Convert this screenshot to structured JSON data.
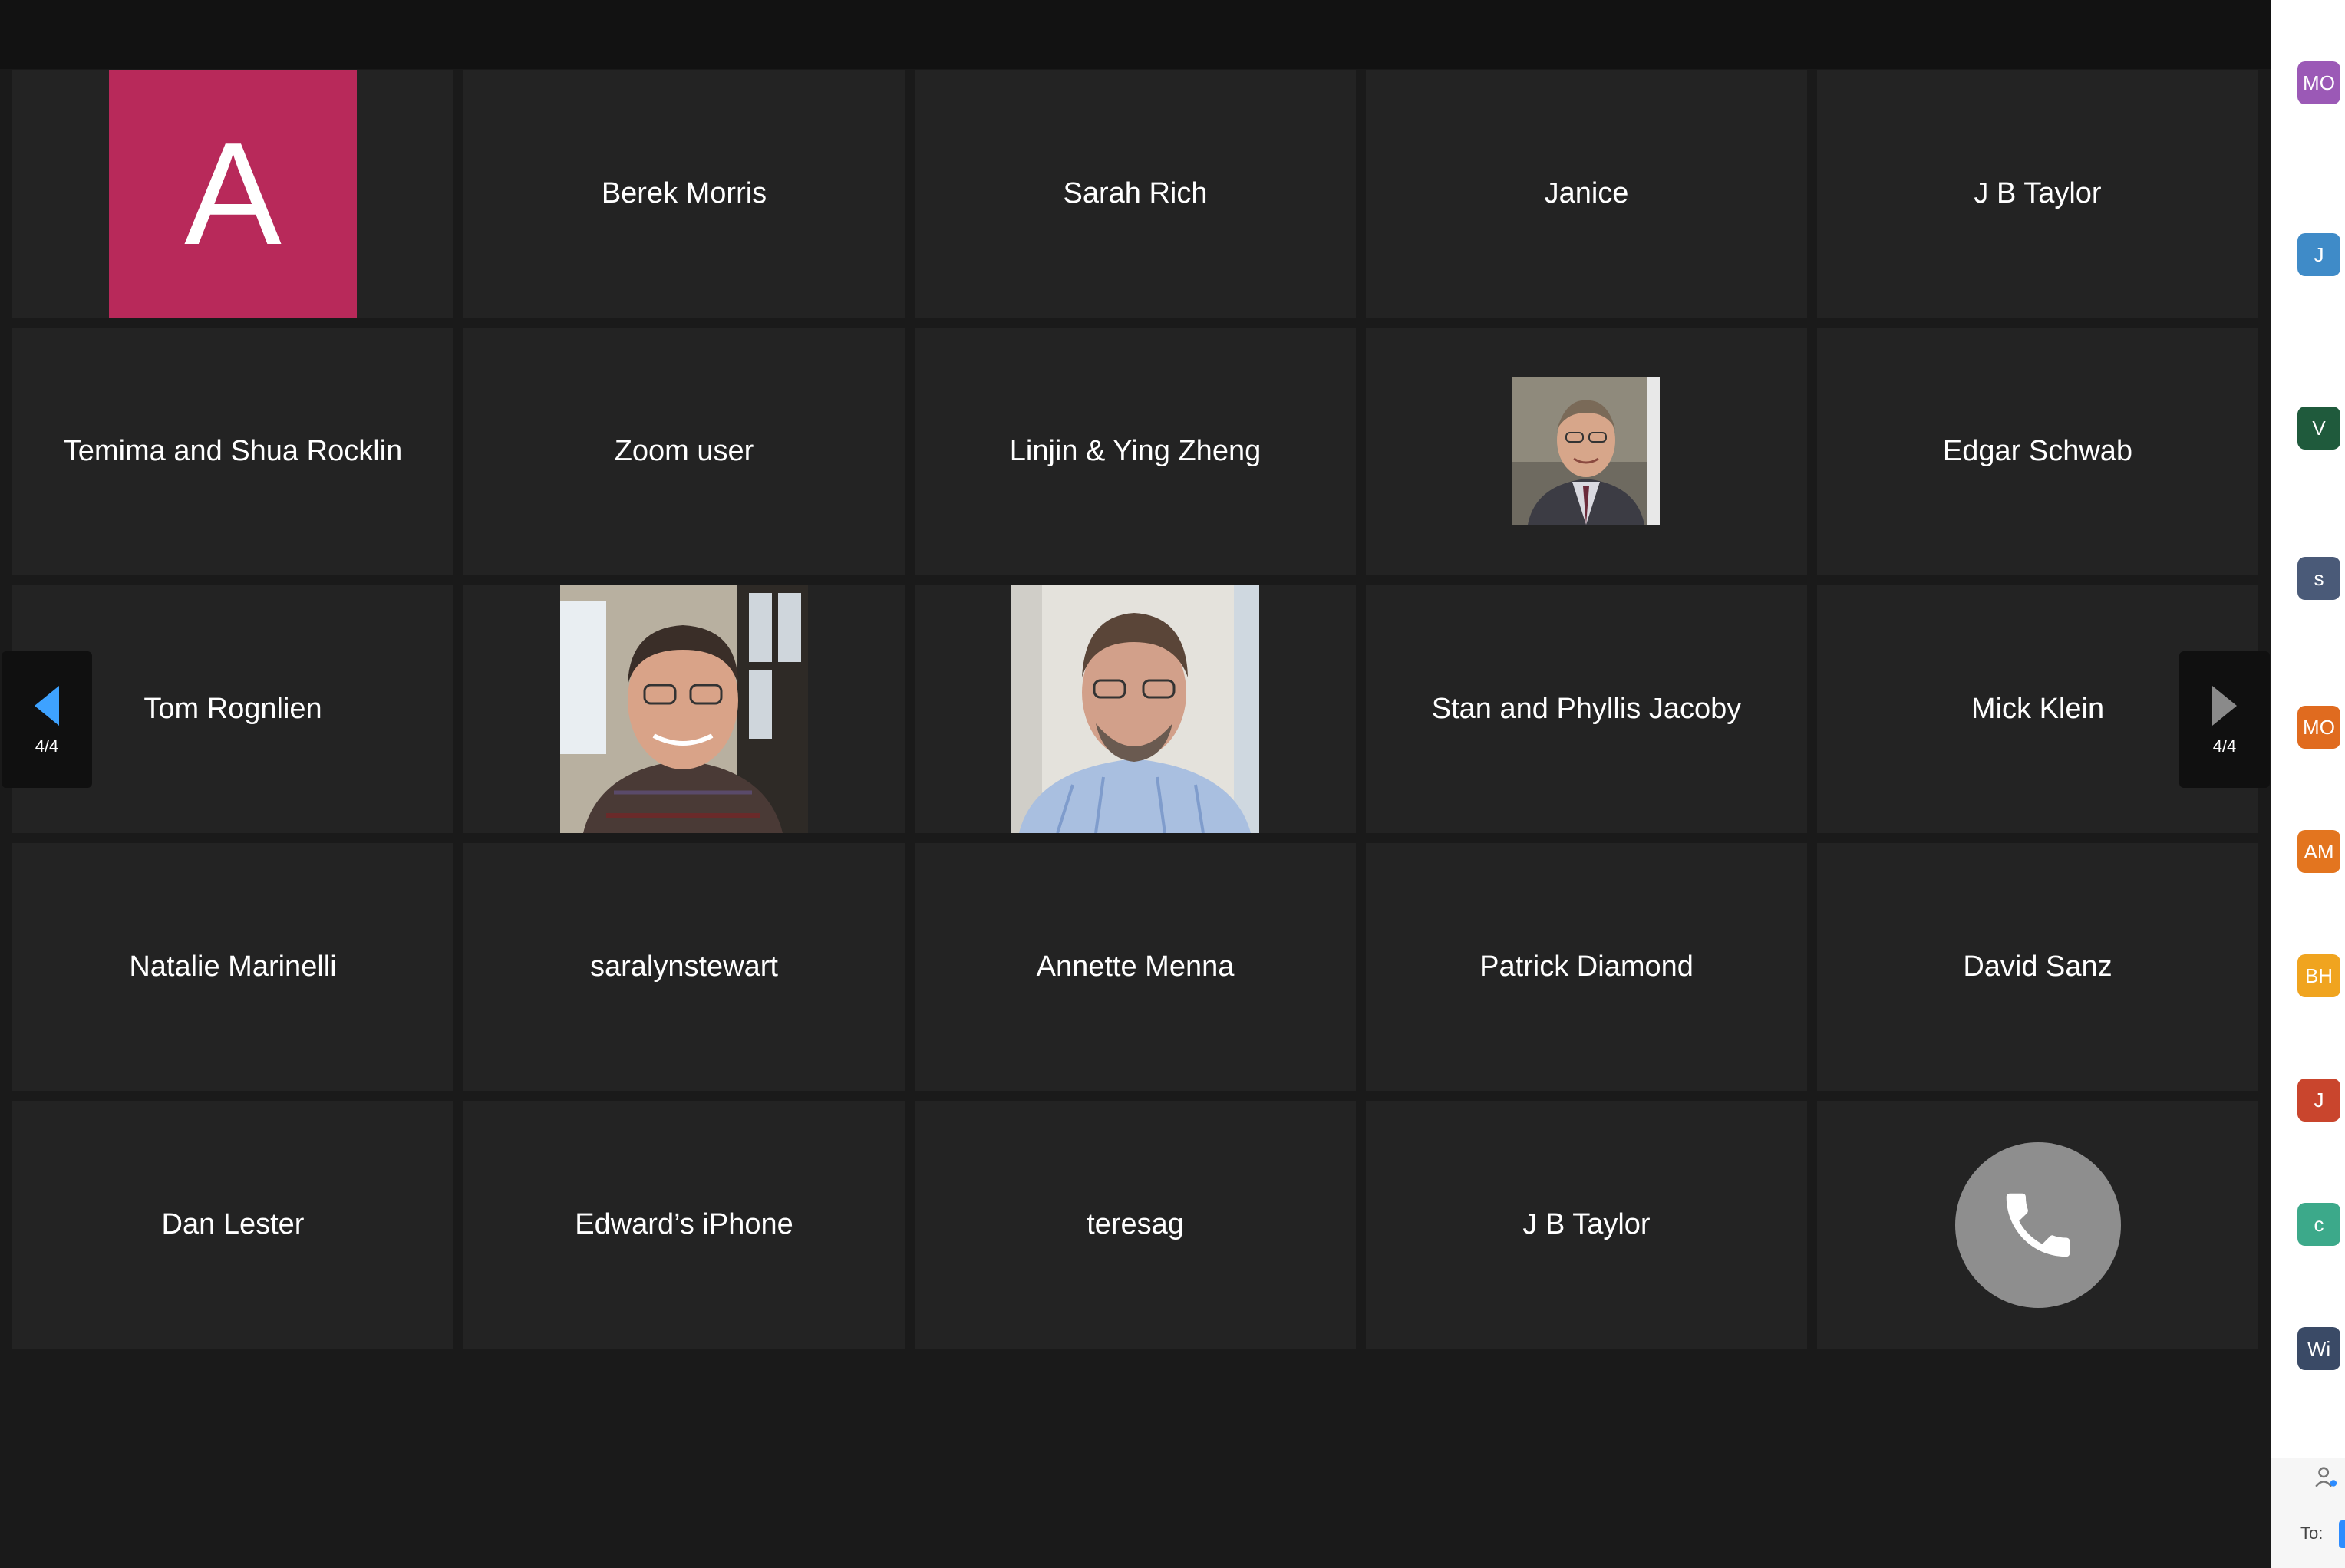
{
  "gallery": {
    "tiles": [
      {
        "name": "",
        "type": "avatar",
        "initial": "A",
        "color": "#b8295a"
      },
      {
        "name": "Berek Morris",
        "type": "name"
      },
      {
        "name": "Sarah Rich",
        "type": "name"
      },
      {
        "name": "Janice",
        "type": "name"
      },
      {
        "name": "J B Taylor",
        "type": "name"
      },
      {
        "name": "Temima and Shua Rocklin",
        "type": "name"
      },
      {
        "name": "Zoom user",
        "type": "name"
      },
      {
        "name": "Linjin & Ying Zheng",
        "type": "name"
      },
      {
        "name": "",
        "type": "photo-small"
      },
      {
        "name": "Edgar Schwab",
        "type": "name"
      },
      {
        "name": "Tom Rognlien",
        "type": "name"
      },
      {
        "name": "",
        "type": "photo"
      },
      {
        "name": "",
        "type": "photo"
      },
      {
        "name": "Stan and Phyllis Jacoby",
        "type": "name"
      },
      {
        "name": "Mick Klein",
        "type": "name"
      },
      {
        "name": "Natalie Marinelli",
        "type": "name"
      },
      {
        "name": "saralynstewart",
        "type": "name"
      },
      {
        "name": "Annette Menna",
        "type": "name"
      },
      {
        "name": "Patrick Diamond",
        "type": "name"
      },
      {
        "name": "David Sanz",
        "type": "name"
      },
      {
        "name": "Dan Lester",
        "type": "name"
      },
      {
        "name": "Edward’s iPhone",
        "type": "name"
      },
      {
        "name": "teresag",
        "type": "name"
      },
      {
        "name": "J B Taylor",
        "type": "name"
      },
      {
        "name": "",
        "type": "phone",
        "icon": "phone-icon"
      }
    ],
    "nav": {
      "prev_page_label": "4/4",
      "next_page_label": "4/4",
      "prev_icon": "chevron-left-icon",
      "next_icon": "chevron-right-icon"
    }
  },
  "sidebar": {
    "avatars": [
      {
        "initials": "MO",
        "color": "#9b59b6"
      },
      {
        "initials": "J",
        "color": "#3f8bc8"
      },
      {
        "initials": "V",
        "color": "#1f5a3c"
      },
      {
        "initials": "s",
        "color": "#4a5a78"
      },
      {
        "initials": "MO",
        "color": "#e06b1f"
      },
      {
        "initials": "AM",
        "color": "#e3751f"
      },
      {
        "initials": "BH",
        "color": "#f0a41f"
      },
      {
        "initials": "J",
        "color": "#c9452d"
      },
      {
        "initials": "c",
        "color": "#3ca98a"
      },
      {
        "initials": "Wi",
        "color": "#3a4a66"
      }
    ],
    "to_label": "To:",
    "person_icon": "person-icon"
  }
}
